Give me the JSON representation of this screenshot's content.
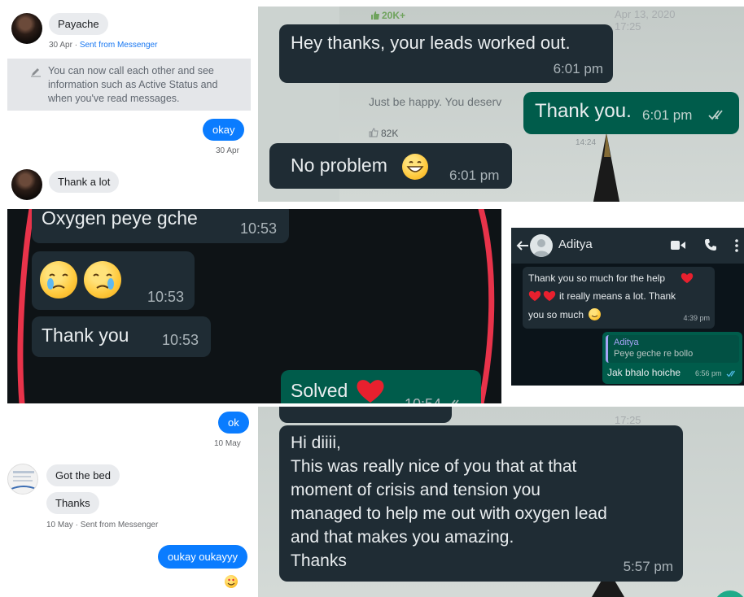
{
  "colors": {
    "messenger_blue": "#0a7cff",
    "wa_incoming": "#1f2c34",
    "wa_outgoing": "#005c4b",
    "wa_bg": "#0b141a",
    "highlight_red": "#e8334a"
  },
  "messenger_top": {
    "contact_name": "Payache",
    "sent_date": "30 Apr",
    "sent_from": "Sent from Messenger",
    "notice": "You can now call each other and see information such as Active Status and when you've read messages.",
    "outgoing_message": "okay",
    "outgoing_date": "30 Apr",
    "incoming_message": "Thank a lot"
  },
  "whatsapp_top": {
    "ghost_likes_1": "20K+",
    "ghost_date": "Apr 13, 2020",
    "ghost_time": "17:25",
    "ghost_text": "Just be happy. You deserv",
    "ghost_likes_2": "82K",
    "ghost_small": "14:24",
    "msg_1": "Hey thanks, your leads worked out.",
    "msg_1_time": "6:01 pm",
    "msg_2": "Thank you.",
    "msg_2_time": "6:01 pm",
    "msg_3": "No problem",
    "msg_3_time": "6:01 pm"
  },
  "whatsapp_mid": {
    "msg_1": "Oxygen peye gche",
    "msg_1_time": "10:53",
    "msg_2_time": "10:53",
    "msg_3": "Thank you",
    "msg_3_time": "10:53",
    "msg_4": "Solved",
    "msg_4_time": "10:54"
  },
  "whatsapp_small": {
    "contact_name": "Aditya",
    "msg_line_1": "Thank you so much for the help",
    "msg_line_2": "it really means a lot. Thank",
    "msg_line_3": "you so much",
    "msg_time": "4:39 pm",
    "quote_name": "Aditya",
    "quote_text": "Peye geche re bollo",
    "reply_text": "Jak bhalo hoiche",
    "reply_time": "6:56 pm"
  },
  "messenger_bottom": {
    "outgoing_message": "ok",
    "outgoing_date": "10 May",
    "msg_1": "Got the bed",
    "msg_2": "Thanks",
    "sent_date": "10 May",
    "sent_from": "Sent from Messenger",
    "outgoing_message_2": "oukay oukayyy"
  },
  "whatsapp_bottom": {
    "ghost_time": "17:25",
    "line_1": "Hi diiii,",
    "line_2": "This was really nice of you that at that",
    "line_3": "moment of crisis and tension you",
    "line_4": "managed to help me out with oxygen lead",
    "line_5": "and that makes you amazing.",
    "line_6": "Thanks",
    "time": "5:57 pm"
  }
}
